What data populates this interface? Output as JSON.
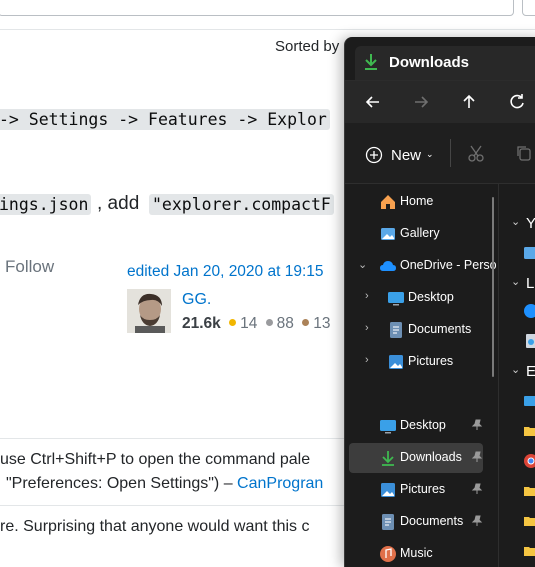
{
  "page": {
    "sorted_by": "Sorted by",
    "path_code": "-> Settings -> Features -> Explor",
    "settings_code": "ings.json",
    "add_text": ", add",
    "compact_code": "\"explorer.compactF",
    "follow": "Follow",
    "edited": "edited Jan 20, 2020 at 19:15",
    "user": {
      "name": "GG.",
      "reputation": "21.6k",
      "gold": "14",
      "silver": "88",
      "bronze": "13"
    },
    "comment1_line1": "use Ctrl+Shift+P to open the command pale",
    "comment1_line2": "\"Preferences: Open Settings\") –",
    "comment1_author": "CanProgran",
    "comment2": "re. Surprising that anyone would want this c"
  },
  "explorer": {
    "tab_title": "Downloads",
    "new_label": "New",
    "nav": {
      "home": "Home",
      "gallery": "Gallery",
      "onedrive": "OneDrive - Perso",
      "od_desktop": "Desktop",
      "od_documents": "Documents",
      "od_pictures": "Pictures",
      "desktop": "Desktop",
      "downloads": "Downloads",
      "pictures": "Pictures",
      "documents": "Documents",
      "music": "Music"
    },
    "right": {
      "y": "Y",
      "l": "L",
      "e": "E"
    },
    "colors": {
      "accent": "#0078d4",
      "background": "#1c1c1c",
      "selected": "#3d3d3d"
    }
  }
}
